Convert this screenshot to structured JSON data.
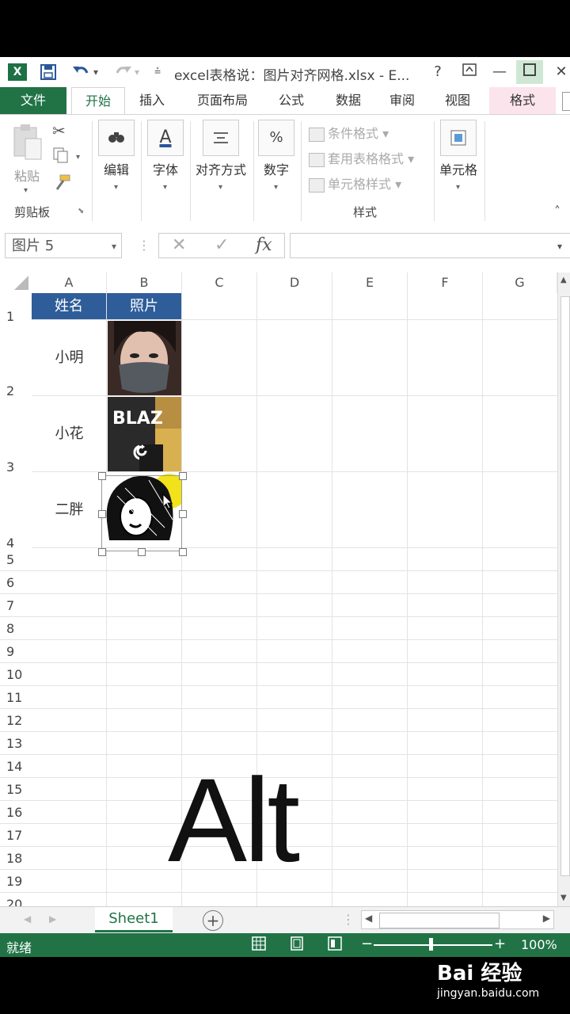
{
  "window": {
    "title": "excel表格说：图片对齐网格.xlsx - E...",
    "app_icon": "X",
    "help": "?",
    "quick_access": {
      "save_icon": "save-icon",
      "undo_icon": "undo-icon",
      "redo_icon": "redo-icon",
      "customize_icon": "customize-icon"
    }
  },
  "tabs": [
    {
      "label": "文件",
      "type": "file"
    },
    {
      "label": "开始",
      "type": "active"
    },
    {
      "label": "插入"
    },
    {
      "label": "页面布局"
    },
    {
      "label": "公式"
    },
    {
      "label": "数据"
    },
    {
      "label": "审阅"
    },
    {
      "label": "视图"
    },
    {
      "label": "格式",
      "type": "format"
    }
  ],
  "ribbon": {
    "clipboard": {
      "paste": "粘贴",
      "group": "剪贴板"
    },
    "editing": "编辑",
    "font": "字体",
    "alignment": "对齐方式",
    "number": "数字",
    "number_icon": "%",
    "styles": {
      "cond": "条件格式",
      "table": "套用表格格式",
      "cell": "单元格样式",
      "group": "样式"
    },
    "cells": "单元格"
  },
  "formula_bar": {
    "name_box": "图片 5",
    "fx": "fx",
    "cancel": "✕",
    "enter": "✓",
    "value": ""
  },
  "columns": [
    "A",
    "B",
    "C",
    "D",
    "E",
    "F",
    "G"
  ],
  "rows": [
    "1",
    "2",
    "3",
    "4",
    "5",
    "6",
    "7",
    "8",
    "9",
    "10",
    "11",
    "12",
    "13",
    "14",
    "15",
    "16",
    "17",
    "18",
    "19",
    "20"
  ],
  "table": {
    "headers": [
      "姓名",
      "照片"
    ],
    "names": [
      "小明",
      "小花",
      "二胖"
    ]
  },
  "overlay_text": "Alt",
  "sheet": {
    "tab": "Sheet1",
    "add": "+"
  },
  "status": {
    "ready": "就绪",
    "zoom": "100%",
    "minus": "−",
    "plus": "+"
  },
  "watermark": {
    "brand": "Bai 经验",
    "url": "jingyan.baidu.com"
  },
  "colors": {
    "excel_green": "#217346",
    "header_blue": "#2e5d9a"
  }
}
